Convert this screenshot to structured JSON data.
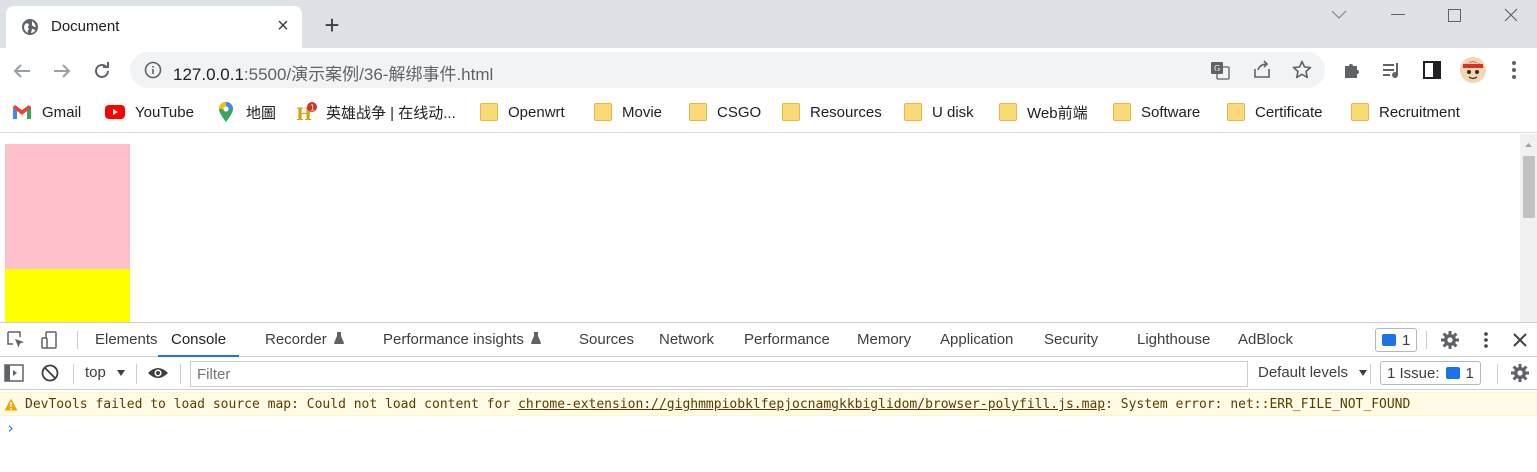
{
  "browser": {
    "tab": {
      "title": "Document",
      "close_label": "×"
    },
    "newtab_label": "+",
    "url": {
      "host": "127.0.0.1",
      "rest": ":5500/演示案例/36-解绑事件.html"
    }
  },
  "bookmarks": [
    {
      "label": "Gmail",
      "icon": "gmail-icon"
    },
    {
      "label": "YouTube",
      "icon": "youtube-icon"
    },
    {
      "label": "地圖",
      "icon": "maps-icon"
    },
    {
      "label": "英雄战争 | 在线动...",
      "icon": "game-icon"
    },
    {
      "label": "Openwrt",
      "icon": "folder-icon"
    },
    {
      "label": "Movie",
      "icon": "folder-icon"
    },
    {
      "label": "CSGO",
      "icon": "folder-icon"
    },
    {
      "label": "Resources",
      "icon": "folder-icon"
    },
    {
      "label": "U disk",
      "icon": "folder-icon"
    },
    {
      "label": "Web前端",
      "icon": "folder-icon"
    },
    {
      "label": "Software",
      "icon": "folder-icon"
    },
    {
      "label": "Certificate",
      "icon": "folder-icon"
    },
    {
      "label": "Recruitment",
      "icon": "folder-icon"
    }
  ],
  "page": {
    "boxes": [
      {
        "color": "#ffc0cb"
      },
      {
        "color": "#ffff00"
      }
    ]
  },
  "devtools": {
    "tabs": [
      "Elements",
      "Console",
      "Recorder",
      "Performance insights",
      "Sources",
      "Network",
      "Performance",
      "Memory",
      "Application",
      "Security",
      "Lighthouse",
      "AdBlock"
    ],
    "active_tab": "Console",
    "issues_count": "1",
    "context": "top",
    "filter_placeholder": "Filter",
    "levels": "Default levels",
    "issues_label": "1 Issue:",
    "issues_badge": "1",
    "warning": {
      "prefix": "DevTools failed to load source map: Could not load content for ",
      "link": "chrome-extension://gighmmpiobklfepjocnamgkkbiglidom/browser-polyfill.js.map",
      "suffix": ": System error: net::ERR_FILE_NOT_FOUND"
    },
    "prompt": "›"
  },
  "colors": {
    "accent": "#1a73e8",
    "warning_bg": "#fffbe5"
  }
}
